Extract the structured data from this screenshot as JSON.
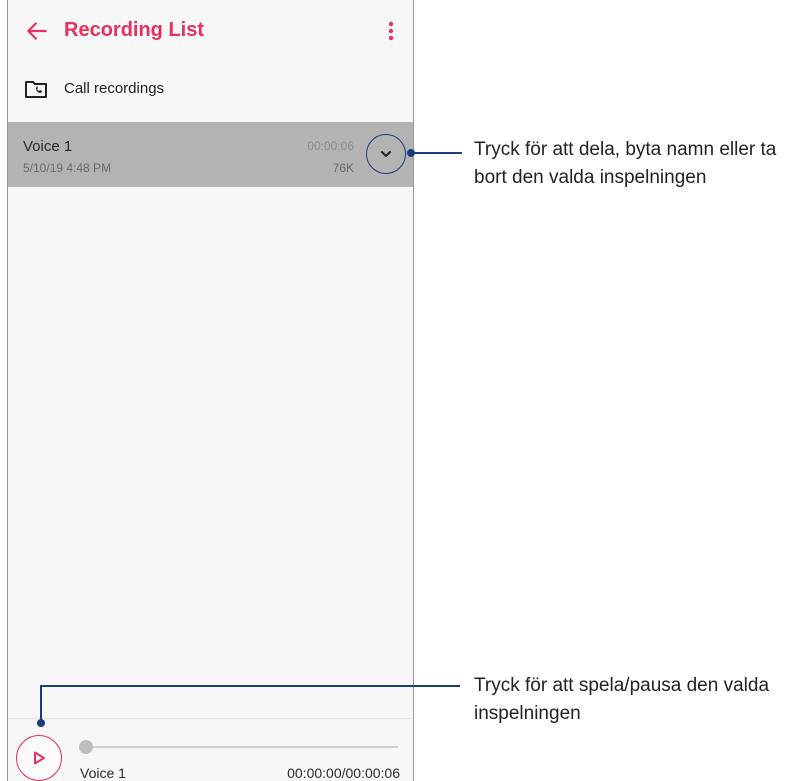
{
  "app_bar": {
    "title": "Recording List",
    "back_icon": "arrow-left-icon",
    "menu_icon": "more-vertical-icon",
    "accent_color": "#e8305f"
  },
  "folder": {
    "label": "Call recordings",
    "icon": "folder-phone-icon"
  },
  "recordings": [
    {
      "name": "Voice 1",
      "date": "5/10/19 4:48 PM",
      "duration": "00:00:06",
      "size": "76K",
      "selected": true
    }
  ],
  "player": {
    "track_name": "Voice 1",
    "time": "00:00:00/00:00:06",
    "progress": 0,
    "play_icon": "play-icon"
  },
  "annotations": {
    "expand": "Tryck för att dela, byta namn eller ta bort den valda inspelningen",
    "play": "Tryck för att spela/pausa den valda inspelningen"
  },
  "colors": {
    "callout": "#1b3d78",
    "selected_row": "#b3b3b3"
  }
}
